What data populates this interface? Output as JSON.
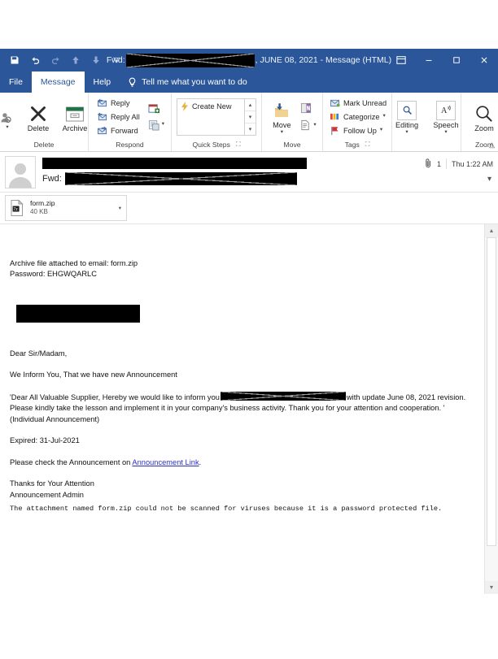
{
  "window": {
    "title_prefix": "Fwd:",
    "title_suffix": ", JUNE 08, 2021  -  Message (HTML)",
    "quick_access": [
      {
        "name": "save-icon",
        "label": "Save"
      },
      {
        "name": "undo-icon",
        "label": "Undo"
      },
      {
        "name": "redo-icon",
        "label": "Redo"
      },
      {
        "name": "previous-item-icon",
        "label": "Previous Item"
      },
      {
        "name": "next-item-icon",
        "label": "Next Item"
      },
      {
        "name": "customize-quick-access-icon",
        "label": "Customize Quick Access Toolbar"
      }
    ],
    "controls": [
      {
        "name": "ribbon-display-options-button",
        "glyph": "⬒"
      },
      {
        "name": "minimize-button",
        "glyph": "─"
      },
      {
        "name": "maximize-button",
        "glyph": "□"
      },
      {
        "name": "close-button",
        "glyph": "✕"
      }
    ]
  },
  "tabs": [
    {
      "label": "File",
      "active": false
    },
    {
      "label": "Message",
      "active": true
    },
    {
      "label": "Help",
      "active": false
    }
  ],
  "tell_me": {
    "placeholder": "Tell me what you want to do",
    "icon": "lightbulb-icon"
  },
  "ribbon": {
    "groups": [
      {
        "label": "Delete",
        "items": [
          {
            "label": "",
            "name": "junk-button",
            "type": "split"
          },
          {
            "label": "Delete",
            "name": "delete-button",
            "type": "big"
          },
          {
            "label": "Archive",
            "name": "archive-button",
            "type": "big"
          }
        ]
      },
      {
        "label": "Respond",
        "items": [
          {
            "label": "Reply",
            "name": "reply-button"
          },
          {
            "label": "Reply All",
            "name": "reply-all-button"
          },
          {
            "label": "Forward",
            "name": "forward-button"
          },
          {
            "label": "",
            "name": "meeting-button"
          },
          {
            "label": "",
            "name": "more-respond-button"
          }
        ]
      },
      {
        "label": "Quick Steps",
        "items": [
          {
            "label": "Create New",
            "name": "create-new-quick-step"
          }
        ]
      },
      {
        "label": "Move",
        "items": [
          {
            "label": "Move",
            "name": "move-button"
          },
          {
            "label": "",
            "name": "onenote-button"
          },
          {
            "label": "",
            "name": "rules-button"
          }
        ]
      },
      {
        "label": "Tags",
        "items": [
          {
            "label": "Mark Unread",
            "name": "mark-unread-button"
          },
          {
            "label": "Categorize",
            "name": "categorize-button"
          },
          {
            "label": "Follow Up",
            "name": "follow-up-button"
          }
        ]
      },
      {
        "label": "",
        "items": [
          {
            "label": "Editing",
            "name": "editing-button"
          },
          {
            "label": "Speech",
            "name": "speech-button"
          }
        ]
      },
      {
        "label": "Zoom",
        "items": [
          {
            "label": "Zoom",
            "name": "zoom-button"
          }
        ]
      }
    ]
  },
  "message": {
    "sender_redacted": true,
    "subject_label": "Fwd:",
    "subject_redacted": true,
    "attachment_count": "1",
    "received": "Thu 1:22 AM"
  },
  "attachment": {
    "filename": "form.zip",
    "size": "40 KB"
  },
  "body": {
    "line_archive": "Archive file attached to email: form.zip",
    "line_password": "Password: EHGWQARLC",
    "salutation": "Dear Sir/Madam,",
    "intro": "We Inform You, That we have new Announcement",
    "quote_part1": "'Dear All Valuable Supplier, Hereby we would like to inform you",
    "quote_part2": "with update June 08, 2021 revision. Please kindly take the lesson and implement it in your company's business activity. Thank you for your attention and cooperation. '",
    "individual": "(Individual Announcement)",
    "expired": "Expired: 31-Jul-2021",
    "check_prefix": "Please check the Announcement on ",
    "link_text": "Announcement Link",
    "check_suffix": ".",
    "thanks": "Thanks for Your Attention",
    "signature": "Announcement Admin",
    "scan_notice": "The attachment named form.zip could not be scanned for viruses because it is a password protected file."
  },
  "colors": {
    "titlebar_blue": "#2b579a",
    "link_blue": "#2b30c4",
    "redaction_black": "#000000",
    "archive_green": "#217346",
    "flag_red": "#d13438",
    "folder_gold": "#e8c170"
  }
}
